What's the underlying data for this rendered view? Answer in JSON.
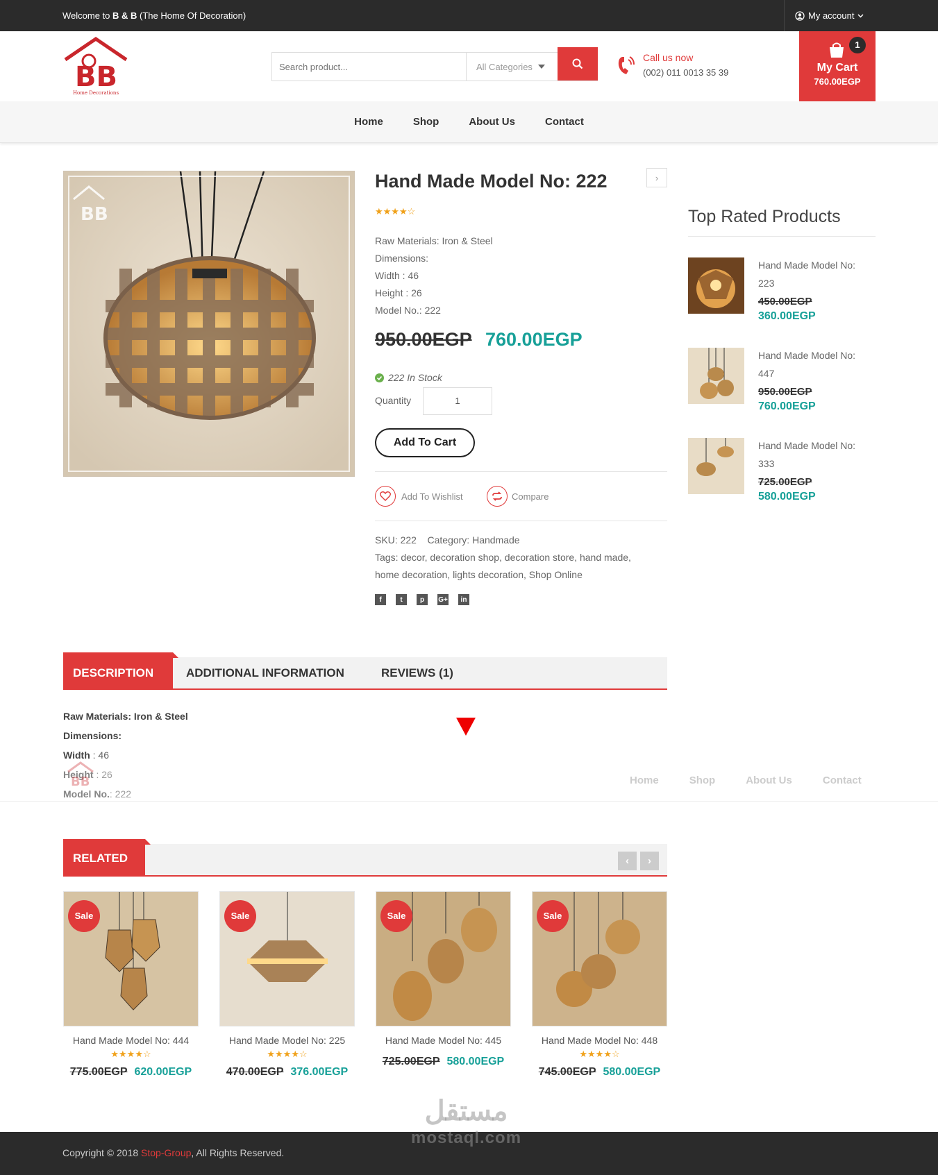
{
  "topbar": {
    "welcome_prefix": "Welcome to ",
    "welcome_brand": "B & B",
    "welcome_suffix": " (The Home Of Decoration)",
    "account": "My account"
  },
  "header": {
    "logo_text": "Home Decorations",
    "search_placeholder": "Search product...",
    "category": "All Categories",
    "call_label": "Call us now",
    "call_number": "(002) 011 0013 35 39",
    "cart_count": "1",
    "cart_label": "My Cart",
    "cart_total": "760.00EGP"
  },
  "nav": [
    "Home",
    "Shop",
    "About Us",
    "Contact"
  ],
  "product": {
    "title": "Hand Made Model No: 222",
    "rating_stars": "★★★★☆",
    "specs": [
      "Raw Materials: Iron & Steel",
      "Dimensions:",
      "Width : 46",
      "Height : 26",
      "Model No.: 222"
    ],
    "old_price": "950.00EGP",
    "new_price": "760.00EGP",
    "stock": "222 In Stock",
    "quantity_label": "Quantity",
    "quantity": "1",
    "add_to_cart": "Add To Cart",
    "wishlist": "Add To Wishlist",
    "compare": "Compare",
    "sku_label": "SKU:",
    "sku": "222",
    "category_label": "Category:",
    "category": "Handmade",
    "tags_label": "Tags:",
    "tags_line1": "decor, decoration shop, decoration store, hand made,",
    "tags_line2": "home decoration, lights decoration, Shop Online",
    "social_icons": [
      "facebook-icon",
      "twitter-icon",
      "pinterest-icon",
      "google-plus-icon",
      "linkedin-icon"
    ]
  },
  "sidebar": {
    "title": "Top Rated Products",
    "items": [
      {
        "name_l1": "Hand Made Model No:",
        "name_l2": "223",
        "old": "450.00EGP",
        "new": "360.00EGP"
      },
      {
        "name_l1": "Hand Made Model No:",
        "name_l2": "447",
        "old": "950.00EGP",
        "new": "760.00EGP"
      },
      {
        "name_l1": "Hand Made Model No:",
        "name_l2": "333",
        "old": "725.00EGP",
        "new": "580.00EGP"
      }
    ]
  },
  "tabs": {
    "description": "DESCRIPTION",
    "additional": "ADDITIONAL INFORMATION",
    "reviews": "REVIEWS (1)"
  },
  "description": {
    "l1_label": "Raw Materials: Iron & Steel",
    "l2_label": "Dimensions:",
    "l3_label": "Width",
    "l3_value": " : 46",
    "l4_label": "Height",
    "l4_value": " : 26",
    "l5_label": "Model No.",
    "l5_value": ": 222"
  },
  "related": {
    "title": "RELATED",
    "prev": "‹",
    "next": "›",
    "items": [
      {
        "sale": "Sale",
        "name": "Hand Made Model No: 444",
        "stars": "★★★★☆",
        "old": "775.00EGP",
        "new": "620.00EGP"
      },
      {
        "sale": "Sale",
        "name": "Hand Made Model No: 225",
        "stars": "★★★★☆",
        "old": "470.00EGP",
        "new": "376.00EGP"
      },
      {
        "sale": "Sale",
        "name": "Hand Made Model No: 445",
        "stars": "",
        "old": "725.00EGP",
        "new": "580.00EGP"
      },
      {
        "sale": "Sale",
        "name": "Hand Made Model No: 448",
        "stars": "★★★★☆",
        "old": "745.00EGP",
        "new": "580.00EGP"
      }
    ]
  },
  "footer": {
    "copy_prefix": "Copyright © 2018 ",
    "brand": "Stop-Group",
    "copy_suffix": ", All Rights Reserved."
  },
  "watermark": {
    "arabic": "مستقل",
    "latin": "mostaql.com"
  },
  "colors": {
    "accent": "#e03a3a",
    "price": "#17a098",
    "dark": "#2b2b2b",
    "star": "#f0a11a"
  }
}
